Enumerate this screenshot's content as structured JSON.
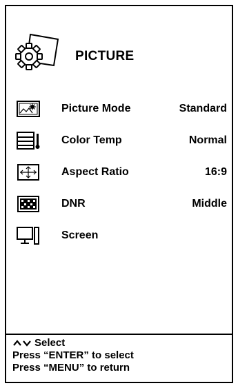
{
  "header": {
    "title": "PICTURE",
    "icon": "gear-document-icon"
  },
  "menu": {
    "items": [
      {
        "label": "Picture Mode",
        "value": "Standard",
        "icon": "landscape-sun-icon"
      },
      {
        "label": "Color Temp",
        "value": "Normal",
        "icon": "thermometer-icon"
      },
      {
        "label": "Aspect Ratio",
        "value": "16:9",
        "icon": "aspect-ratio-icon"
      },
      {
        "label": "DNR",
        "value": "Middle",
        "icon": "noise-reduction-icon"
      },
      {
        "label": "Screen",
        "value": "",
        "icon": "monitor-icon"
      }
    ]
  },
  "footer": {
    "nav_label": "Select",
    "nav_icon": "up-down-arrows-icon",
    "enter_hint": "Press “ENTER” to select",
    "menu_hint": "Press “MENU” to return"
  }
}
